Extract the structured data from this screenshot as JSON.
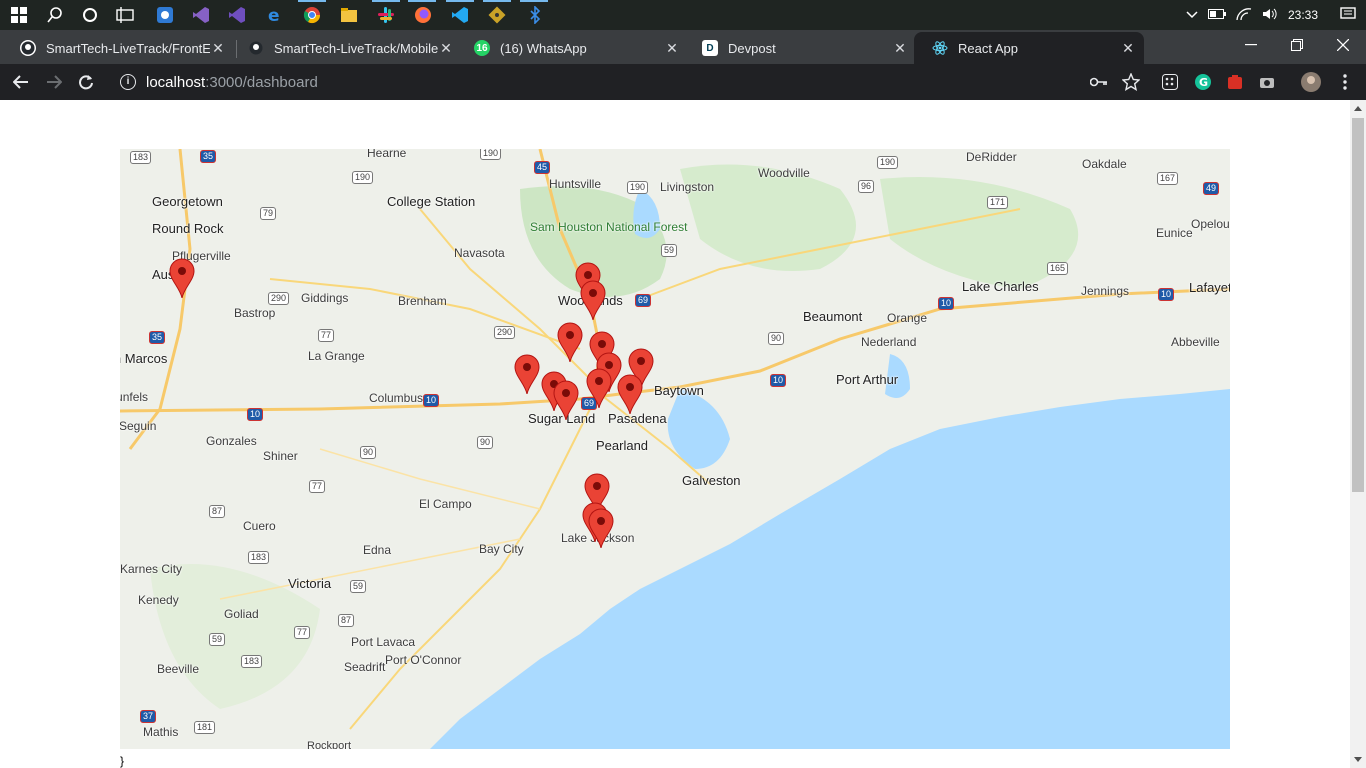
{
  "taskbar": {
    "icons": [
      "windows-start-icon",
      "search-icon",
      "cortana-icon",
      "task-view-icon",
      "browser-blue-icon",
      "visual-studio-icon",
      "visual-studio-code-insiders-icon",
      "edge-icon",
      "chrome-icon",
      "file-explorer-icon",
      "slack-icon",
      "firefox-icon",
      "vscode-icon",
      "git-icon",
      "bluetooth-icon"
    ],
    "clock": "23:33"
  },
  "tabs": [
    {
      "title": "SmartTech-LiveTrack/FrontEnd",
      "favicon": "github-icon",
      "active": false
    },
    {
      "title": "SmartTech-LiveTrack/Mobile-A",
      "favicon": "github-icon",
      "active": false
    },
    {
      "title": "(16) WhatsApp",
      "favicon": "whatsapp-icon",
      "active": false
    },
    {
      "title": "Devpost",
      "favicon": "devpost-icon",
      "active": false
    },
    {
      "title": "React App",
      "favicon": "react-icon",
      "active": true
    }
  ],
  "omnibox": {
    "host": "localhost",
    "rest": ":3000/dashboard"
  },
  "map": {
    "cities": [
      {
        "name": "Hearne"
      },
      {
        "name": "Huntsville"
      },
      {
        "name": "Livingston"
      },
      {
        "name": "Woodville"
      },
      {
        "name": "DeRidder"
      },
      {
        "name": "Oakdale"
      },
      {
        "name": "Georgetown"
      },
      {
        "name": "College Station"
      },
      {
        "name": "Sam Houston National Forest"
      },
      {
        "name": "Round Rock"
      },
      {
        "name": "Pflugerville"
      },
      {
        "name": "Navasota"
      },
      {
        "name": "Eunice"
      },
      {
        "name": "Opelousas"
      },
      {
        "name": "Austin"
      },
      {
        "name": "Giddings"
      },
      {
        "name": "Brenham"
      },
      {
        "name": "Woodlands"
      },
      {
        "name": "Lake Charles"
      },
      {
        "name": "Jennings"
      },
      {
        "name": "Lafayette"
      },
      {
        "name": "Bastrop"
      },
      {
        "name": "Beaumont"
      },
      {
        "name": "Orange"
      },
      {
        "name": "Nederland"
      },
      {
        "name": "Abbeville"
      },
      {
        "name": "San Marcos"
      },
      {
        "name": "La Grange"
      },
      {
        "name": "Port Arthur"
      },
      {
        "name": "Baytown"
      },
      {
        "name": "New Braunfels"
      },
      {
        "name": "Columbus"
      },
      {
        "name": "Sugar Land"
      },
      {
        "name": "Pasadena"
      },
      {
        "name": "Seguin"
      },
      {
        "name": "Gonzales"
      },
      {
        "name": "Pearland"
      },
      {
        "name": "Shiner"
      },
      {
        "name": "Galveston"
      },
      {
        "name": "El Campo"
      },
      {
        "name": "Cuero"
      },
      {
        "name": "Edna"
      },
      {
        "name": "Bay City"
      },
      {
        "name": "Lake Jackson"
      },
      {
        "name": "Karnes City"
      },
      {
        "name": "Victoria"
      },
      {
        "name": "Kenedy"
      },
      {
        "name": "Goliad"
      },
      {
        "name": "Port Lavaca"
      },
      {
        "name": "Seadrift"
      },
      {
        "name": "Port O'Connor"
      },
      {
        "name": "Beeville"
      },
      {
        "name": "Mathis"
      },
      {
        "name": "Rockport"
      }
    ],
    "marker_count": 15,
    "colors": {
      "water": "#aadaff",
      "land": "#eef0ea",
      "park": "#c8e6c0",
      "marker": "#ea4335",
      "road": "#f9d77a"
    }
  },
  "page_footer": "}"
}
